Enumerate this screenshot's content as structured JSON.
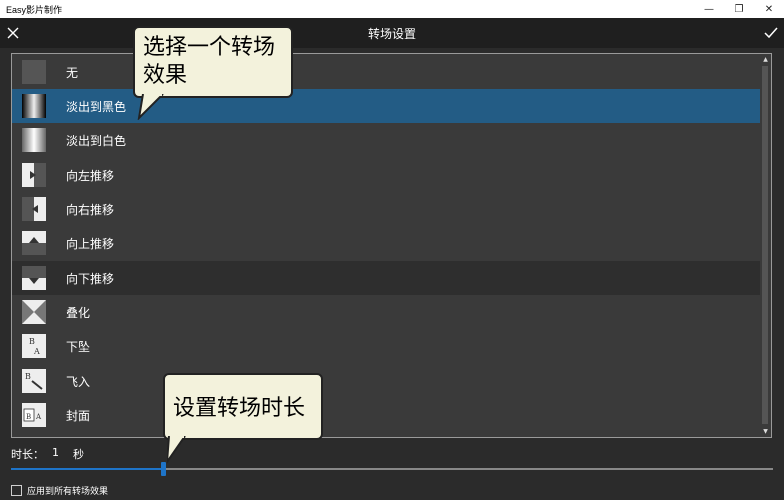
{
  "window": {
    "app_title": "Easy影片制作",
    "minimize": "—",
    "maximize": "❐",
    "close": "✕"
  },
  "header": {
    "title": "转场设置",
    "close_icon": "close-icon",
    "confirm_icon": "check-icon"
  },
  "transitions": [
    {
      "label": "无",
      "icon": "none-transition-icon",
      "state": "normal"
    },
    {
      "label": "淡出到黑色",
      "icon": "fade-to-black-icon",
      "state": "selected"
    },
    {
      "label": "淡出到白色",
      "icon": "fade-to-white-icon",
      "state": "normal"
    },
    {
      "label": "向左推移",
      "icon": "push-left-icon",
      "state": "normal"
    },
    {
      "label": "向右推移",
      "icon": "push-right-icon",
      "state": "normal"
    },
    {
      "label": "向上推移",
      "icon": "push-up-icon",
      "state": "normal"
    },
    {
      "label": "向下推移",
      "icon": "push-down-icon",
      "state": "hover"
    },
    {
      "label": "叠化",
      "icon": "dissolve-icon",
      "state": "normal"
    },
    {
      "label": "下坠",
      "icon": "drop-down-icon",
      "state": "normal"
    },
    {
      "label": "飞入",
      "icon": "fly-in-icon",
      "state": "normal"
    },
    {
      "label": "封面",
      "icon": "cover-icon",
      "state": "normal"
    }
  ],
  "duration": {
    "label": "时长：",
    "value": "1",
    "unit": "秒",
    "slider_fraction": 0.2
  },
  "apply_all": {
    "label": "应用到所有转场效果",
    "checked": false
  },
  "callouts": {
    "select_effect": "选择一个转场效果",
    "set_duration": "设置转场时长"
  },
  "colors": {
    "accent": "#1e74c8",
    "selected_row": "#235c85",
    "callout_bg": "#f3f2dc"
  }
}
